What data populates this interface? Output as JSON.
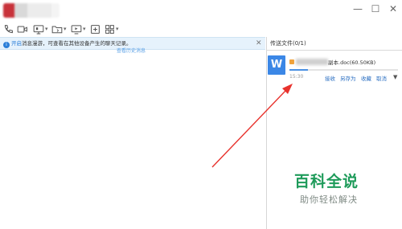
{
  "window": {
    "minimize_glyph": "—",
    "maximize_glyph": "☐",
    "close_glyph": "✕"
  },
  "toolbar": {
    "icons": [
      "phone-icon",
      "video-icon",
      "screen-share-icon",
      "folder-icon",
      "remote-desktop-icon",
      "add-app-icon",
      "apps-grid-icon"
    ]
  },
  "notice": {
    "info_glyph": "i",
    "highlight": "开启",
    "text": "消息漫游，可查看在其他设备产生的聊天记录。",
    "close_glyph": "✕"
  },
  "history_link": "查看历史消息",
  "panel": {
    "title": "传送文件(0/1)",
    "file": {
      "icon_letter": "W",
      "name_suffix": "副本.doc(60.50KB)",
      "time": "15:30",
      "progress": 0.17,
      "actions": {
        "receive": "接收",
        "save_as": "另存为",
        "favorite": "收藏",
        "cancel": "取消"
      },
      "dropdown_glyph": "▼"
    }
  },
  "watermark": {
    "title": "百科全说",
    "subtitle": "助你轻松解决"
  },
  "colors": {
    "accent": "#2b7ed8",
    "notice_bg": "#e6f2fc",
    "arrow": "#e8322d",
    "watermark": "#1e9b5a"
  }
}
